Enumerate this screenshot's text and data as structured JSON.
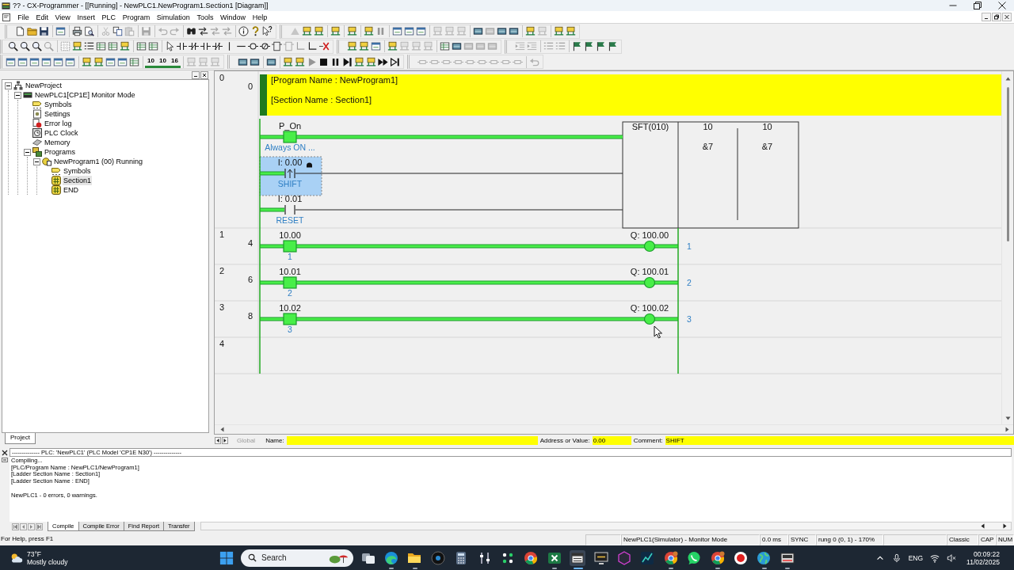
{
  "window": {
    "title": "?? - CX-Programmer - [[Running] - NewPLC1.NewProgram1.Section1 [Diagram]]"
  },
  "menu": [
    "File",
    "Edit",
    "View",
    "Insert",
    "PLC",
    "Program",
    "Simulation",
    "Tools",
    "Window",
    "Help"
  ],
  "toolbars": [
    [
      [
        [
          {
            "kind": "page",
            "disabled": false
          },
          {
            "kind": "folder",
            "disabled": false
          },
          {
            "kind": "save",
            "disabled": false
          }
        ],
        [
          {
            "kind": "window",
            "disabled": false
          }
        ],
        [
          {
            "kind": "printer",
            "disabled": false
          },
          {
            "kind": "preview",
            "disabled": false
          }
        ],
        [
          {
            "kind": "scissors",
            "disabled": true
          },
          {
            "kind": "copy",
            "disabled": false
          },
          {
            "kind": "paste",
            "disabled": true
          }
        ],
        [
          {
            "kind": "save",
            "disabled": true
          }
        ],
        [
          {
            "kind": "undo",
            "disabled": true
          },
          {
            "kind": "redo",
            "disabled": true
          }
        ],
        [
          {
            "kind": "binoculars",
            "disabled": false
          },
          {
            "kind": "replace",
            "disabled": false
          },
          {
            "kind": "replace",
            "disabled": true
          },
          {
            "kind": "replace",
            "disabled": true
          }
        ],
        [
          {
            "kind": "info",
            "disabled": false
          },
          {
            "kind": "question",
            "disabled": false
          },
          {
            "kind": "helppointer",
            "disabled": false
          }
        ]
      ],
      [
        [
          {
            "kind": "triangle",
            "disabled": true
          },
          {
            "kind": "device",
            "disabled": false
          },
          {
            "kind": "device",
            "disabled": false
          }
        ],
        [
          {
            "kind": "device",
            "disabled": false
          }
        ],
        [
          {
            "kind": "device",
            "disabled": false
          }
        ],
        [
          {
            "kind": "device",
            "disabled": false
          },
          {
            "kind": "pause",
            "disabled": true
          }
        ],
        [
          {
            "kind": "window",
            "disabled": false
          },
          {
            "kind": "window",
            "disabled": false
          },
          {
            "kind": "window",
            "disabled": false
          }
        ],
        [
          {
            "kind": "device",
            "disabled": true
          },
          {
            "kind": "device",
            "disabled": true
          },
          {
            "kind": "device",
            "disabled": true
          }
        ],
        [
          {
            "kind": "panel",
            "disabled": false
          },
          {
            "kind": "panel",
            "disabled": true
          },
          {
            "kind": "panel",
            "disabled": false
          },
          {
            "kind": "panel",
            "disabled": false
          }
        ],
        [
          {
            "kind": "device",
            "disabled": false
          },
          {
            "kind": "device",
            "disabled": true
          }
        ],
        [
          {
            "kind": "device",
            "disabled": false
          },
          {
            "kind": "device",
            "disabled": false
          }
        ]
      ]
    ],
    [
      [
        [
          {
            "kind": "zoom",
            "disabled": false
          },
          {
            "kind": "zoom",
            "disabled": false
          },
          {
            "kind": "zoom",
            "disabled": false
          },
          {
            "kind": "zoom",
            "disabled": true
          }
        ],
        [
          {
            "kind": "grid",
            "disabled": false
          },
          {
            "kind": "device",
            "disabled": false
          },
          {
            "kind": "list",
            "disabled": false
          },
          {
            "kind": "table",
            "disabled": false
          },
          {
            "kind": "table",
            "disabled": false
          },
          {
            "kind": "device",
            "disabled": false
          }
        ],
        [
          {
            "kind": "table",
            "disabled": false
          },
          {
            "kind": "table",
            "disabled": false
          }
        ],
        [
          {
            "kind": "pointer",
            "disabled": false
          },
          {
            "kind": "contact",
            "disabled": false
          },
          {
            "kind": "nccontact",
            "disabled": false
          },
          {
            "kind": "contact",
            "disabled": false
          },
          {
            "kind": "nccontact",
            "disabled": false
          },
          {
            "kind": "vline",
            "disabled": false
          },
          {
            "kind": "hline",
            "disabled": false
          },
          {
            "kind": "coil",
            "disabled": false
          },
          {
            "kind": "nccoil",
            "disabled": false
          },
          {
            "kind": "instruction",
            "disabled": false
          },
          {
            "kind": "instruction",
            "disabled": true
          },
          {
            "kind": "corner",
            "disabled": true
          },
          {
            "kind": "corner",
            "disabled": false
          },
          {
            "kind": "delete",
            "disabled": false
          }
        ]
      ],
      [
        [
          {
            "kind": "device",
            "disabled": false
          },
          {
            "kind": "device",
            "disabled": false
          },
          {
            "kind": "window",
            "disabled": false
          }
        ],
        [
          {
            "kind": "device",
            "disabled": false
          },
          {
            "kind": "device",
            "disabled": true
          },
          {
            "kind": "device",
            "disabled": true
          },
          {
            "kind": "device",
            "disabled": true
          }
        ],
        [
          {
            "kind": "table",
            "disabled": false
          },
          {
            "kind": "panel",
            "disabled": false
          },
          {
            "kind": "panel",
            "disabled": true
          },
          {
            "kind": "panel",
            "disabled": true
          },
          {
            "kind": "panel",
            "disabled": true
          }
        ]
      ],
      [
        [
          {
            "kind": "indent",
            "disabled": true
          },
          {
            "kind": "indent",
            "disabled": true
          }
        ],
        [
          {
            "kind": "list",
            "disabled": true
          },
          {
            "kind": "list",
            "disabled": true
          }
        ],
        [
          {
            "kind": "flag",
            "disabled": false
          },
          {
            "kind": "flag",
            "disabled": false
          },
          {
            "kind": "flag",
            "disabled": false
          },
          {
            "kind": "flag",
            "disabled": false
          }
        ]
      ]
    ],
    [
      [
        [
          {
            "kind": "window",
            "disabled": false
          },
          {
            "kind": "window",
            "disabled": false
          },
          {
            "kind": "window",
            "disabled": false
          },
          {
            "kind": "window",
            "disabled": false
          },
          {
            "kind": "window",
            "disabled": false
          },
          {
            "kind": "window",
            "disabled": false
          }
        ],
        [
          {
            "kind": "device",
            "disabled": false
          },
          {
            "kind": "device",
            "disabled": false
          },
          {
            "kind": "window",
            "disabled": false
          },
          {
            "kind": "window",
            "disabled": false
          },
          {
            "kind": "table",
            "disabled": false
          }
        ],
        [
          {
            "kind": "number",
            "label": "10",
            "disabled": false
          },
          {
            "kind": "number",
            "label": "10",
            "disabled": false
          },
          {
            "kind": "number",
            "label": "16",
            "disabled": false
          }
        ],
        [
          {
            "kind": "device",
            "disabled": true
          },
          {
            "kind": "device",
            "disabled": true
          },
          {
            "kind": "device",
            "disabled": true
          }
        ]
      ],
      [
        [
          {
            "kind": "panel",
            "disabled": false
          },
          {
            "kind": "panel",
            "disabled": false
          }
        ],
        [
          {
            "kind": "panel",
            "disabled": false
          }
        ],
        [
          {
            "kind": "device",
            "disabled": false
          },
          {
            "kind": "device",
            "disabled": false
          },
          {
            "kind": "play",
            "disabled": true
          },
          {
            "kind": "stop",
            "disabled": false
          },
          {
            "kind": "pause",
            "disabled": false
          },
          {
            "kind": "step",
            "disabled": false
          },
          {
            "kind": "device",
            "disabled": false
          },
          {
            "kind": "device",
            "disabled": false
          },
          {
            "kind": "ffw",
            "disabled": false
          },
          {
            "kind": "end",
            "disabled": false
          }
        ]
      ],
      [
        [
          {
            "kind": "linebox",
            "disabled": true
          },
          {
            "kind": "linebox",
            "disabled": true
          },
          {
            "kind": "linebox",
            "disabled": true
          },
          {
            "kind": "linebox",
            "disabled": true
          },
          {
            "kind": "linebox",
            "disabled": true
          },
          {
            "kind": "linebox",
            "disabled": true
          },
          {
            "kind": "linebox",
            "disabled": true
          },
          {
            "kind": "linebox",
            "disabled": true
          },
          {
            "kind": "linebox",
            "disabled": true
          }
        ],
        [
          {
            "kind": "undo",
            "disabled": true
          }
        ]
      ]
    ]
  ],
  "project_tree": {
    "items": [
      {
        "label": "NewProject",
        "kind": "project",
        "expanded": true,
        "selected": false,
        "children": [
          {
            "label": "NewPLC1[CP1E] Monitor Mode",
            "kind": "plc",
            "expanded": true,
            "selected": false,
            "children": [
              {
                "label": "Symbols",
                "kind": "symbols",
                "selected": false
              },
              {
                "label": "Settings",
                "kind": "settings",
                "selected": false
              },
              {
                "label": "Error log",
                "kind": "errorlog",
                "selected": false
              },
              {
                "label": "PLC Clock",
                "kind": "clock",
                "selected": false
              },
              {
                "label": "Memory",
                "kind": "memory",
                "selected": false
              },
              {
                "label": "Programs",
                "kind": "programs",
                "expanded": true,
                "selected": false,
                "children": [
                  {
                    "label": "NewProgram1 (00) Running",
                    "kind": "program",
                    "expanded": true,
                    "selected": false,
                    "children": [
                      {
                        "label": "Symbols",
                        "kind": "symbols",
                        "selected": false
                      },
                      {
                        "label": "Section1",
                        "kind": "section",
                        "selected": true
                      },
                      {
                        "label": "END",
                        "kind": "section",
                        "selected": false
                      }
                    ]
                  }
                ]
              }
            ]
          }
        ]
      }
    ],
    "tabs": [
      {
        "label": "Project",
        "selected": true
      }
    ]
  },
  "diagram": {
    "rungs": [
      {
        "number": "0",
        "step": "0",
        "comment_lines": [
          "[Program Name : NewProgram1]",
          "[Section Name : Section1]"
        ],
        "inputs": [
          {
            "kind": "contact",
            "operand": "P_On",
            "comment": "Always ON ...",
            "on": true,
            "selected": false
          },
          {
            "kind": "rising-contact",
            "operand": "I: 0.00",
            "comment": "SHIFT",
            "on": false,
            "selected": true
          },
          {
            "kind": "contact",
            "operand": "I: 0.01",
            "comment": "RESET",
            "on": false,
            "selected": false
          }
        ],
        "instruction": {
          "name": "SFT(010)",
          "operands": [
            {
              "value": "10",
              "comment": "&7"
            },
            {
              "value": "10",
              "comment": "&7"
            }
          ]
        }
      },
      {
        "number": "1",
        "step": "4",
        "inputs": [
          {
            "kind": "contact",
            "operand": "10.00",
            "comment": "1",
            "on": true,
            "selected": false
          }
        ],
        "output": {
          "operand": "Q: 100.00",
          "comment": "1",
          "on": true
        }
      },
      {
        "number": "2",
        "step": "6",
        "inputs": [
          {
            "kind": "contact",
            "operand": "10.01",
            "comment": "2",
            "on": true,
            "selected": false
          }
        ],
        "output": {
          "operand": "Q: 100.01",
          "comment": "2",
          "on": true
        }
      },
      {
        "number": "3",
        "step": "8",
        "inputs": [
          {
            "kind": "contact",
            "operand": "10.02",
            "comment": "3",
            "on": true,
            "selected": false
          }
        ],
        "output": {
          "operand": "Q: 100.02",
          "comment": "3",
          "on": true
        }
      },
      {
        "number": "4"
      }
    ]
  },
  "info_bar": {
    "scope": {
      "label": "Global",
      "disabled": true
    },
    "fields": [
      {
        "label": "Name:"
      },
      {
        "label": "Address or Value:",
        "value": "0.00"
      },
      {
        "label": "Comment:",
        "value": "SHIFT"
      }
    ]
  },
  "output": {
    "header": "-------------- PLC: 'NewPLC1' (PLC Model 'CP1E N30') --------------",
    "blocks": [
      [
        "Compiling...",
        "[PLC/Program Name : NewPLC1/NewProgram1]",
        "[Ladder Section Name : Section1]",
        "[Ladder Section Name : END]"
      ],
      [
        "NewPLC1 - 0 errors, 0 warnings."
      ]
    ],
    "tabs": [
      {
        "label": "Compile",
        "selected": true
      },
      {
        "label": "Compile Error",
        "selected": false
      },
      {
        "label": "Find Report",
        "selected": false
      },
      {
        "label": "Transfer",
        "selected": false
      }
    ]
  },
  "status_bar": {
    "help": "For Help, press F1",
    "panes": [
      "NewPLC1(Simulator) - Monitor Mode",
      "0.0 ms",
      "SYNC",
      "rung 0 (0, 1) - 170%",
      "Classic",
      "CAP",
      "NUM"
    ]
  },
  "taskbar": {
    "weather": {
      "temperature": "73°F",
      "condition": "Mostly cloudy"
    },
    "search": {
      "label": "Search"
    },
    "apps": [
      {
        "kind": "taskview",
        "open": false,
        "selected": false
      },
      {
        "kind": "swirl",
        "open": true,
        "selected": false
      },
      {
        "kind": "folder",
        "open": true,
        "selected": false
      },
      {
        "kind": "darkcircle",
        "open": false,
        "selected": false
      },
      {
        "kind": "calculator",
        "open": false,
        "selected": false
      },
      {
        "kind": "sliders",
        "open": false,
        "selected": false
      },
      {
        "kind": "dots",
        "open": false,
        "selected": false
      },
      {
        "kind": "ring",
        "open": false,
        "selected": false
      },
      {
        "kind": "sheet",
        "open": true,
        "selected": false
      },
      {
        "kind": "plcwindow",
        "open": true,
        "selected": true
      },
      {
        "kind": "monitor",
        "open": false,
        "selected": false
      },
      {
        "kind": "hexagon",
        "open": false,
        "selected": false
      },
      {
        "kind": "chart",
        "open": false,
        "selected": false
      },
      {
        "kind": "ringbadge",
        "open": true,
        "selected": false
      },
      {
        "kind": "chat",
        "open": false,
        "selected": false
      },
      {
        "kind": "ringbadge",
        "open": true,
        "selected": false
      },
      {
        "kind": "record",
        "open": false,
        "selected": false
      },
      {
        "kind": "globe",
        "open": true,
        "selected": false
      },
      {
        "kind": "devwindow",
        "open": true,
        "selected": false
      }
    ],
    "tray": {
      "language": "ENG",
      "time": "00:09:22",
      "date": "11/02/2025"
    }
  }
}
